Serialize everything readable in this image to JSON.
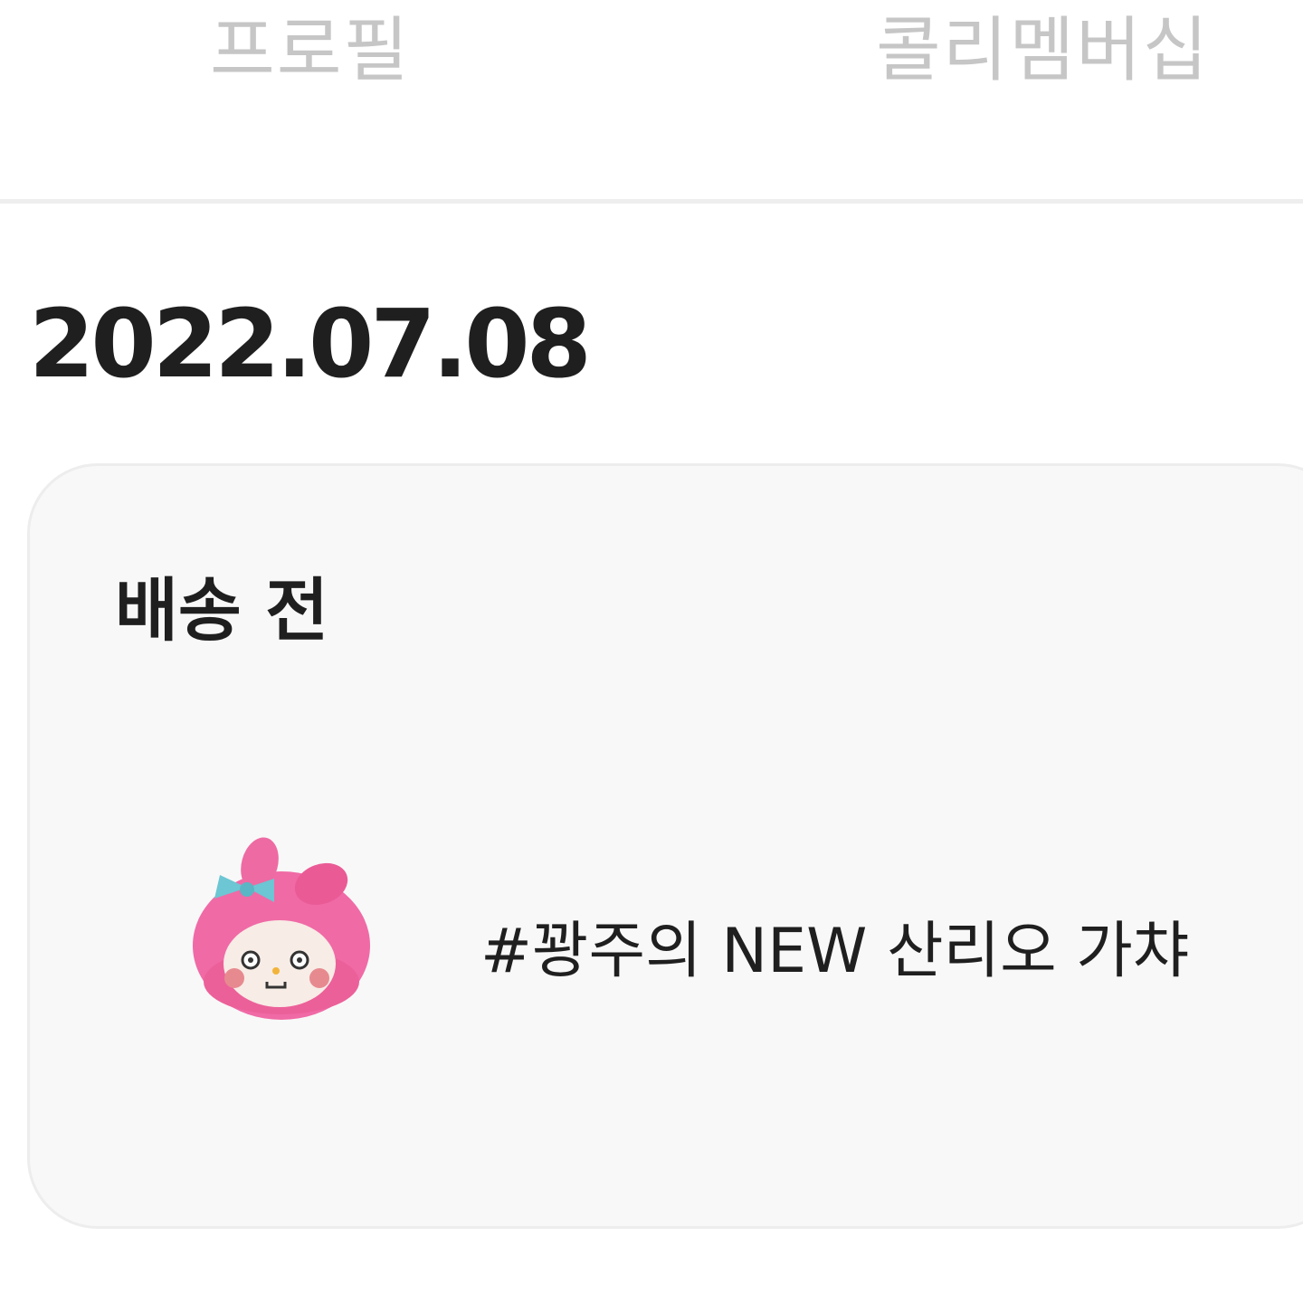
{
  "tabs": {
    "profile_label": "프로필",
    "membership_label": "콜리멤버십"
  },
  "order": {
    "date": "2022.07.08",
    "status": "배송 전",
    "product": {
      "name": "#꽝주의 NEW 산리오 가챠",
      "thumbnail": "pink-plush-character-image"
    }
  },
  "colors": {
    "tab_inactive": "#c6c6c6",
    "text_primary": "#1f1f1f",
    "card_background": "#f8f8f8",
    "divider": "#eeeeee"
  }
}
